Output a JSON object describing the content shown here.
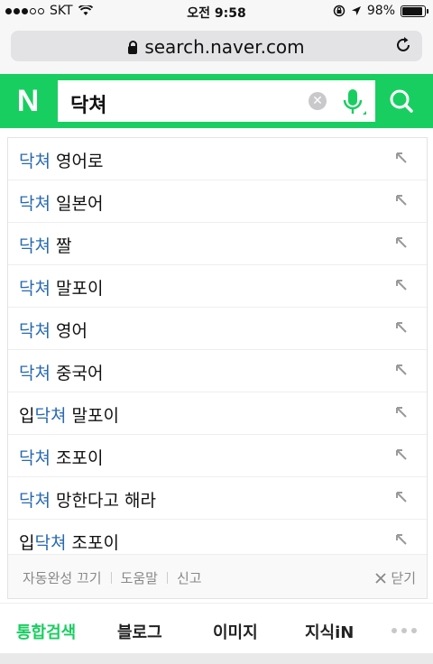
{
  "status": {
    "carrier": "SKT",
    "time": "오전 9:58",
    "battery": "98%",
    "battery_level": 0.98,
    "signal_bars_filled": 3,
    "signal_bars_total": 5
  },
  "browser": {
    "url": "search.naver.com"
  },
  "search": {
    "logo": "N",
    "query": "닥쳐",
    "accent": "#19ce60"
  },
  "suggestions": [
    {
      "pre": "",
      "hl": "닥쳐",
      "post": " 영어로"
    },
    {
      "pre": "",
      "hl": "닥쳐",
      "post": " 일본어"
    },
    {
      "pre": "",
      "hl": "닥쳐",
      "post": " 짤"
    },
    {
      "pre": "",
      "hl": "닥쳐",
      "post": " 말포이"
    },
    {
      "pre": "",
      "hl": "닥쳐",
      "post": " 영어"
    },
    {
      "pre": "",
      "hl": "닥쳐",
      "post": " 중국어"
    },
    {
      "pre": "입",
      "hl": "닥쳐",
      "post": " 말포이"
    },
    {
      "pre": "",
      "hl": "닥쳐",
      "post": " 조포이"
    },
    {
      "pre": "",
      "hl": "닥쳐",
      "post": " 망한다고 해라"
    },
    {
      "pre": "입",
      "hl": "닥쳐",
      "post": " 조포이"
    }
  ],
  "footer": {
    "autocomplete_off": "자동완성 끄기",
    "help": "도움말",
    "report": "신고",
    "close": "닫기"
  },
  "tabs": [
    {
      "label": "통합검색",
      "active": true
    },
    {
      "label": "블로그",
      "active": false
    },
    {
      "label": "이미지",
      "active": false
    },
    {
      "label": "지식iN",
      "active": false
    }
  ]
}
